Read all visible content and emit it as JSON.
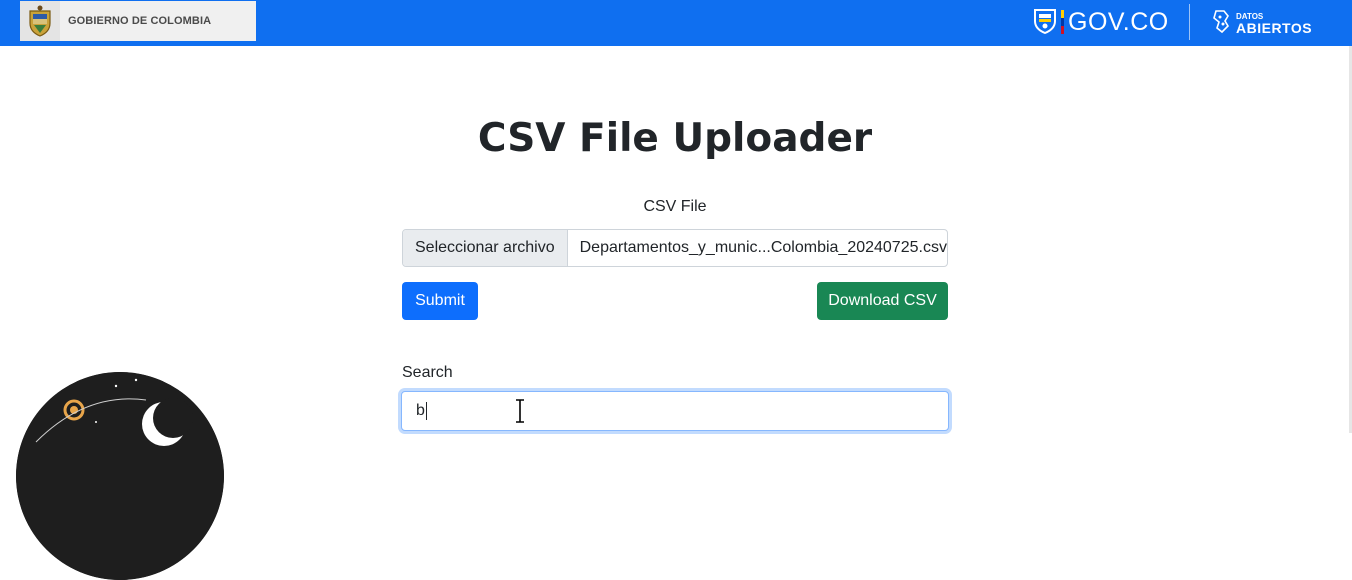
{
  "header": {
    "gov_label": "GOBIERNO DE COLOMBIA",
    "govco_label": "GOV.CO",
    "datos_small": "DATOS",
    "datos_big": "ABIERTOS",
    "bar_color": "#0f6ff0"
  },
  "main": {
    "title": "CSV File Uploader",
    "file_label": "CSV File",
    "file_button": "Seleccionar archivo",
    "file_name": "Departamentos_y_munic...Colombia_20240725.csv",
    "submit_label": "Submit",
    "download_label": "Download CSV",
    "search_label": "Search",
    "search_value": "b"
  },
  "icons": [
    "colombia-crest-icon",
    "govco-crest-icon",
    "datos-abiertos-icon",
    "text-cursor-icon"
  ],
  "colors": {
    "submit": "#0d6efd",
    "download": "#198754"
  }
}
